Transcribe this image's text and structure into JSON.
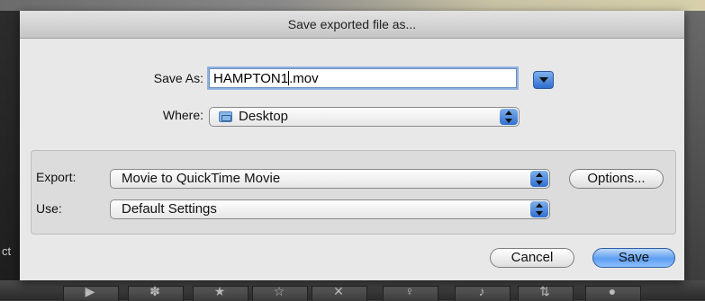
{
  "background": {
    "left_fragment": "ct",
    "toolbar_glyphs": [
      "▶",
      "✽",
      "★",
      "☆",
      "✕",
      "♀",
      "♪",
      "⇅",
      "●"
    ]
  },
  "dialog": {
    "title": "Save exported file as...",
    "save_as_label": "Save As:",
    "filename_before_caret": "HAMPTON1",
    "filename_after_caret": ".mov",
    "where_label": "Where:",
    "where_value": "Desktop",
    "export_label": "Export:",
    "export_value": "Movie to QuickTime Movie",
    "options_button": "Options...",
    "use_label": "Use:",
    "use_value": "Default Settings",
    "cancel_button": "Cancel",
    "save_button": "Save"
  },
  "icons": {
    "expand": "chevron-down-icon",
    "folder": "folder-icon",
    "stepper": "up-down-arrows-icon"
  },
  "colors": {
    "accent": "#4a8fe8",
    "sheet_bg": "#e8e8e8"
  }
}
